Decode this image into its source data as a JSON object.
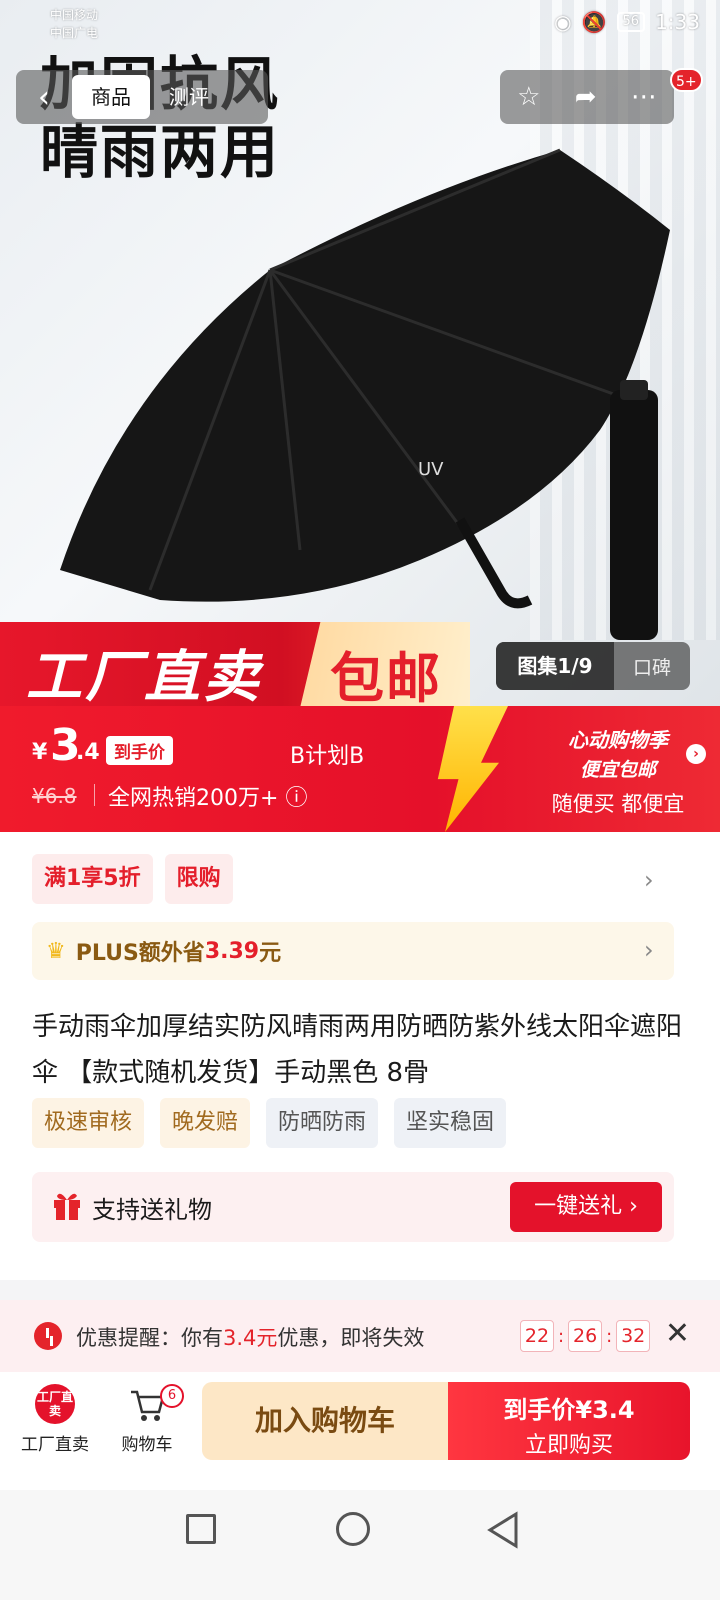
{
  "status_bar": {
    "carrier1": "中国移动",
    "carrier2": "中国广电",
    "battery": "56",
    "time": "1:33"
  },
  "hero": {
    "title_line1": "加固抗风",
    "title_line2": "晴雨两用",
    "tabs": [
      "商品",
      "测评"
    ],
    "notif_badge": "5+",
    "banner_left": "工厂直卖",
    "banner_right": "包邮",
    "gallery": "图集1/9",
    "reviews": "口碑",
    "umbrella_print": "UV"
  },
  "price": {
    "currency": "¥",
    "integer": "3",
    "decimal": ".4",
    "tag": "到手价",
    "plan": "B计划B",
    "original": "¥6.8",
    "hot_sales": "全网热销200万+",
    "promo_line1": "心动购物季",
    "promo_line2": "便宜包邮",
    "promo_line3": "随便买 都便宜"
  },
  "promotions": [
    "满1享5折",
    "限购"
  ],
  "plus": {
    "prefix": "PLUS额外省",
    "amount": "3.39",
    "suffix": "元"
  },
  "product": {
    "title": "手动雨伞加厚结实防风晴雨两用防晒防紫外线太阳伞遮阳伞 【款式随机发货】手动黑色 8骨",
    "tags_warm": [
      "极速审核",
      "晚发赔"
    ],
    "tags_cool": [
      "防晒防雨",
      "坚实稳固"
    ]
  },
  "gift": {
    "label": "支持送礼物",
    "button": "一键送礼 ›"
  },
  "reminder": {
    "prefix": "优惠提醒：你有",
    "amount": "3.4元",
    "suffix": "优惠，即将失效",
    "hh": "22",
    "mm": "26",
    "ss": "32"
  },
  "bottom_bar": {
    "factory_icon": "工厂直卖",
    "factory_label": "工厂直卖",
    "cart_label": "购物车",
    "cart_count": "6",
    "add_to_cart": "加入购物车",
    "buy_price": "到手价¥3.4",
    "buy_now": "立即购买"
  },
  "colors": {
    "brand_red": "#e4122b",
    "gold": "#f1b81b"
  }
}
